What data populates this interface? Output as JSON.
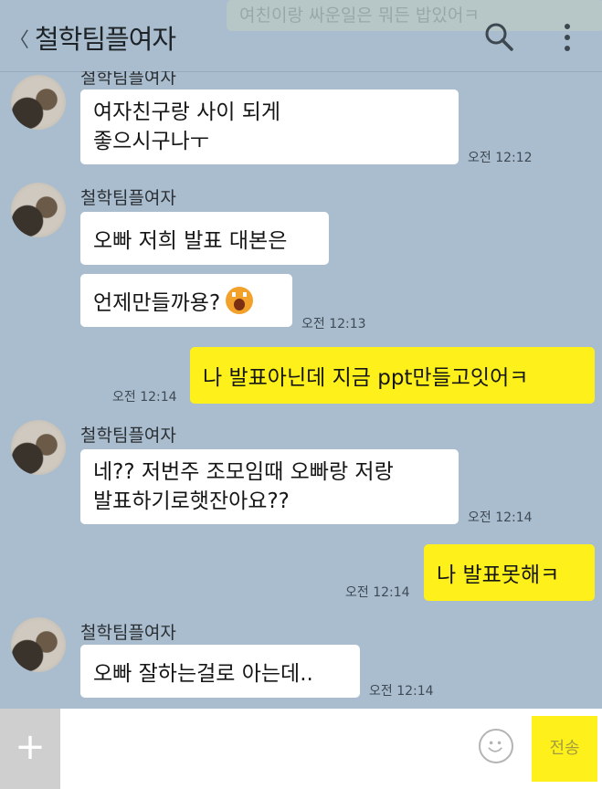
{
  "header": {
    "back_icon": "chevron-left-icon",
    "title": "철학팀플여자",
    "search_icon": "search-icon",
    "more_icon": "more-vertical-icon",
    "ghost_preview": "여친이랑 싸운일은 뭐든 밥있어ㅋ"
  },
  "messages": {
    "m1": {
      "sender": "철학팀플여자",
      "text": "여자친구랑 사이 되게\n좋으시구나ㅜ",
      "time": "오전 12:12"
    },
    "m2": {
      "sender": "철학팀플여자",
      "text": "오빠 저희 발표 대본은"
    },
    "m3": {
      "text": "언제만들까용?",
      "emoji": "shocked-face-emoji",
      "time": "오전 12:13"
    },
    "m4": {
      "text": "나 발표아닌데 지금 ppt만들고잇어ㅋ",
      "time": "오전 12:14"
    },
    "m5": {
      "sender": "철학팀플여자",
      "text": "네?? 저번주 조모임때 오빠랑 저랑\n발표하기로햇잔아요??",
      "time": "오전 12:14"
    },
    "m6": {
      "text": "나 발표못해ㅋ",
      "time": "오전 12:14"
    },
    "m7": {
      "sender": "철학팀플여자",
      "text": "오빠 잘하는걸로 아는데..",
      "time": "오전 12:14"
    }
  },
  "input": {
    "plus_label": "+",
    "emoji_icon": "smile-icon",
    "send_label": "전송"
  },
  "colors": {
    "background": "#a9bdce",
    "my_bubble": "#fef01b",
    "their_bubble": "#ffffff"
  }
}
